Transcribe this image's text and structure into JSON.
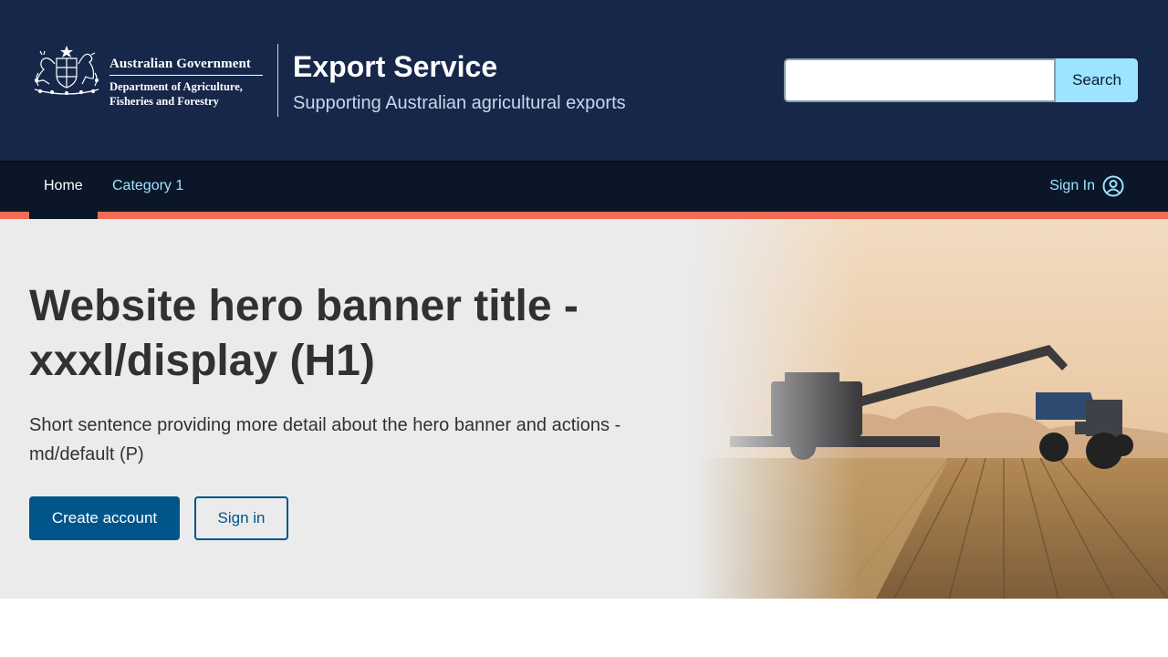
{
  "header": {
    "gov_name": "Australian Government",
    "department_line1": "Department of Agriculture,",
    "department_line2": "Fisheries and Forestry",
    "service_title": "Export Service",
    "service_subtitle": "Supporting Australian agricultural exports",
    "search": {
      "value": "",
      "button_label": "Search"
    }
  },
  "nav": {
    "items": [
      {
        "label": "Home",
        "active": true
      },
      {
        "label": "Category 1",
        "active": false
      }
    ],
    "sign_in_label": "Sign In",
    "sign_in_icon": "user-circle-icon"
  },
  "hero": {
    "title": "Website hero banner title - xxxl/display (H1)",
    "text": "Short sentence providing more detail about the hero banner and actions - md/default (P)",
    "primary_button": "Create account",
    "secondary_button": "Sign in"
  },
  "colors": {
    "header_bg": "#16274a",
    "nav_bg": "#0b1729",
    "accent": "#f16b55",
    "link": "#9ce4ff",
    "primary": "#00558b",
    "hero_bg": "#ebebeb"
  }
}
